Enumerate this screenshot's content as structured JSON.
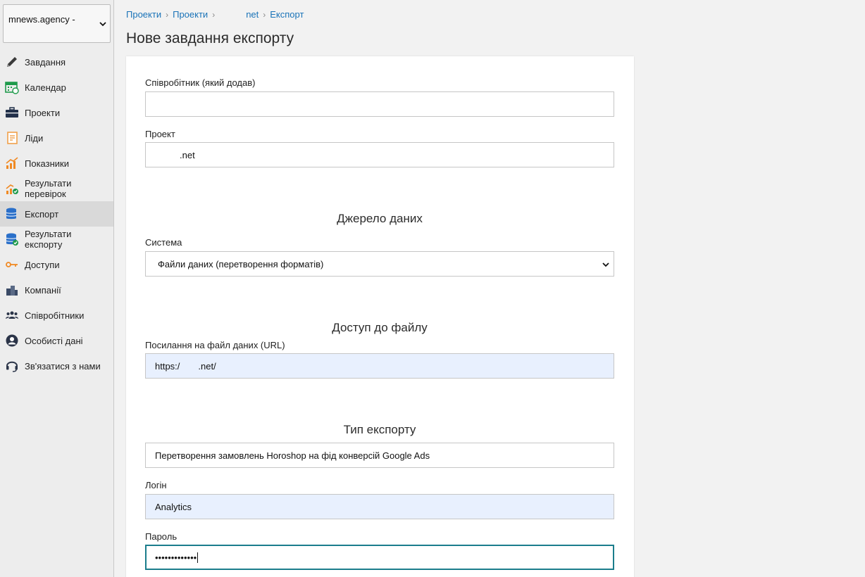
{
  "org_selector": {
    "value": "mnews.agency -"
  },
  "sidebar": {
    "items": [
      {
        "label": "Завдання",
        "icon": "pencil-icon"
      },
      {
        "label": "Календар",
        "icon": "calendar-icon"
      },
      {
        "label": "Проекти",
        "icon": "briefcase-icon"
      },
      {
        "label": "Ліди",
        "icon": "notepad-icon"
      },
      {
        "label": "Показники",
        "icon": "chart-icon"
      },
      {
        "label": "Результати\nперевірок",
        "icon": "chart-check-icon"
      },
      {
        "label": "Експорт",
        "icon": "database-icon",
        "active": true
      },
      {
        "label": "Результати\nекспорту",
        "icon": "database-check-icon"
      },
      {
        "label": "Доступи",
        "icon": "key-icon"
      },
      {
        "label": "Компанії",
        "icon": "buildings-icon"
      },
      {
        "label": "Співробітники",
        "icon": "people-icon"
      },
      {
        "label": "Особисті дані",
        "icon": "user-circle-icon"
      },
      {
        "label": "Зв'язатися з нами",
        "icon": "headset-icon"
      }
    ]
  },
  "breadcrumb": {
    "items": [
      "Проекти",
      "Проекти",
      "net",
      "Експорт"
    ]
  },
  "page_title": "Нове завдання експорту",
  "form": {
    "employee": {
      "label": "Співробітник (який додав)",
      "value": ""
    },
    "project": {
      "label": "Проект",
      "value": ".net"
    },
    "section_source": "Джерело даних",
    "system": {
      "label": "Система",
      "value": "Файли даних (перетворення форматів)"
    },
    "section_access": "Доступ до файлу",
    "file_url": {
      "label": "Посилання на файл даних (URL)",
      "value_prefix": "https:/",
      "value_suffix": ".net/"
    },
    "section_type": "Тип експорту",
    "export_type": {
      "value": "Перетворення замовлень Horoshop на фід конверсій Google Ads"
    },
    "login": {
      "label": "Логін",
      "value": "Analytics"
    },
    "password": {
      "label": "Пароль",
      "value": "•••••••••••••"
    }
  },
  "colors": {
    "link": "#1a73b8",
    "active_nav": "#d9d9d9",
    "autofill_bg": "#e8f0fe",
    "focus_border": "#1b7d8c"
  }
}
